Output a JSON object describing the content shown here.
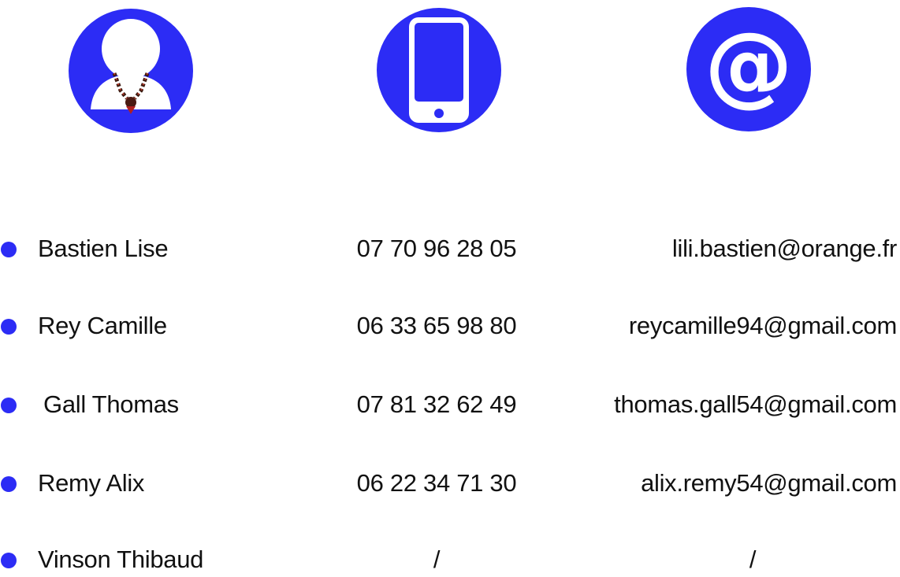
{
  "colors": {
    "accent": "#2c2cf5",
    "text": "#111111",
    "background": "#ffffff"
  },
  "header_icons": [
    {
      "icon": "person-icon"
    },
    {
      "icon": "smartphone-icon"
    },
    {
      "icon": "at-sign-icon"
    }
  ],
  "contacts": [
    {
      "name": "Bastien Lise",
      "phone": "07 70 96 28 05",
      "email": "lili.bastien@orange.fr"
    },
    {
      "name": "Rey Camille",
      "phone": "06 33 65 98 80",
      "email": "reycamille94@gmail.com"
    },
    {
      "name": "Gall Thomas",
      "phone": "07 81 32 62 49",
      "email": "thomas.gall54@gmail.com"
    },
    {
      "name": "Remy Alix",
      "phone": "06 22 34 71 30",
      "email": "alix.remy54@gmail.com"
    },
    {
      "name": "Vinson Thibaud",
      "phone": "/",
      "email": "/"
    }
  ]
}
